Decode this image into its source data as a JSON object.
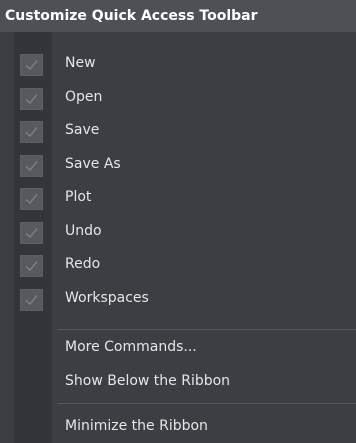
{
  "menu": {
    "title": "Customize Quick Access Toolbar",
    "checked_items": [
      {
        "label": "New",
        "checked": true,
        "icon": "check-icon"
      },
      {
        "label": "Open",
        "checked": true,
        "icon": "check-icon"
      },
      {
        "label": "Save",
        "checked": true,
        "icon": "check-icon"
      },
      {
        "label": "Save As",
        "checked": true,
        "icon": "check-icon"
      },
      {
        "label": "Plot",
        "checked": true,
        "icon": "check-icon"
      },
      {
        "label": "Undo",
        "checked": true,
        "icon": "check-icon"
      },
      {
        "label": "Redo",
        "checked": true,
        "icon": "check-icon"
      },
      {
        "label": "Workspaces",
        "checked": true,
        "icon": "check-icon"
      }
    ],
    "more_commands": "More Commands...",
    "show_below_ribbon": "Show Below the Ribbon",
    "minimize_ribbon": "Minimize the Ribbon"
  },
  "colors": {
    "menu_background": "#3b3e42",
    "header_background": "#4d5055",
    "gutter_background": "#32353a",
    "checkbox_background": "#56595e",
    "checkmark": "#7a7d82",
    "text": "#e6e6e6"
  }
}
